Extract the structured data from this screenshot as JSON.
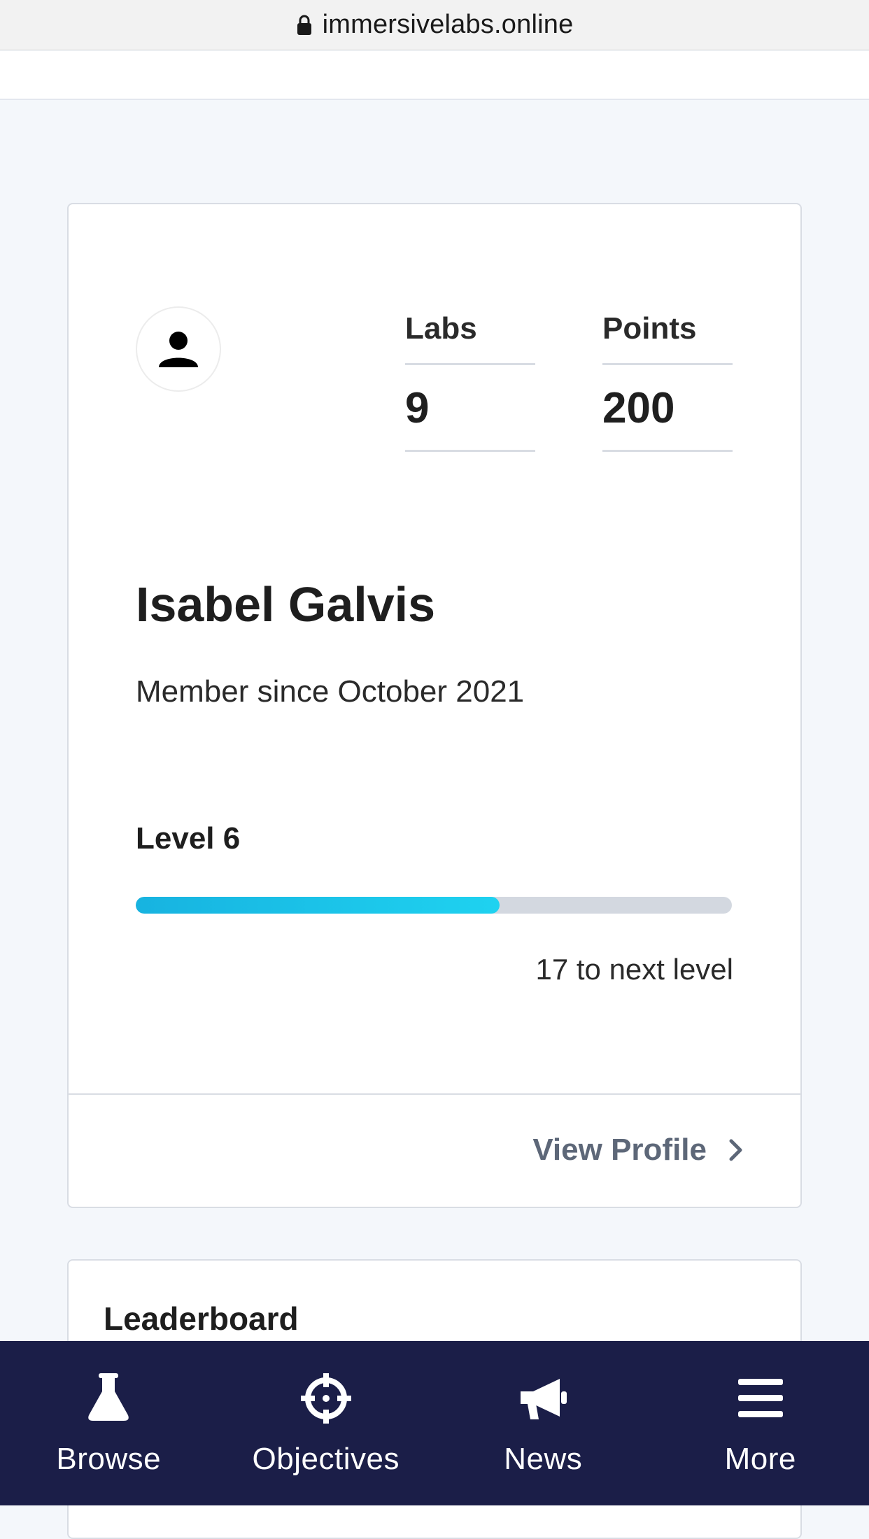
{
  "browser": {
    "url": "immersivelabs.online"
  },
  "profile": {
    "stats": [
      {
        "label": "Labs",
        "value": "9"
      },
      {
        "label": "Points",
        "value": "200"
      }
    ],
    "name": "Isabel Galvis",
    "member_since": "Member since October 2021",
    "level_label": "Level 6",
    "level_progress_percent": 61,
    "next_level_text": "17 to next level",
    "view_profile_label": "View Profile"
  },
  "leaderboard": {
    "title": "Leaderboard"
  },
  "bottom_nav": {
    "items": [
      {
        "label": "Browse",
        "icon": "flask-icon"
      },
      {
        "label": "Objectives",
        "icon": "crosshair-icon"
      },
      {
        "label": "News",
        "icon": "megaphone-icon"
      },
      {
        "label": "More",
        "icon": "hamburger-menu-icon"
      }
    ]
  },
  "colors": {
    "nav_background": "#1b1e48",
    "progress_fill": "#17b3e0",
    "progress_track": "#d3d8e0",
    "link_gray": "#5d6778"
  }
}
